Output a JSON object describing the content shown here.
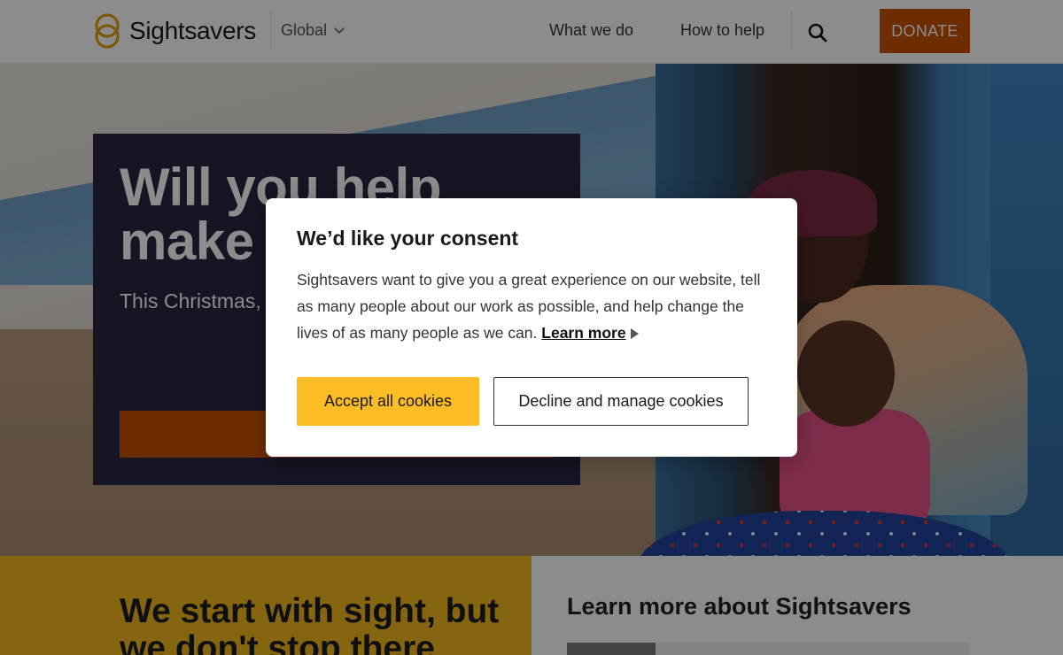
{
  "header": {
    "brand": "Sightsavers",
    "region": "Global",
    "nav": [
      "What we do",
      "How to help"
    ],
    "donate_label": "DONATE"
  },
  "hero": {
    "title": "Will you help make a future",
    "subtitle": "This Christmas, children and fam",
    "cta_label": ""
  },
  "lower": {
    "left_title": "We start with sight, but we don't stop there",
    "right_title": "Learn more about Sightsavers"
  },
  "consent": {
    "title": "We’d like your consent",
    "body": "Sightsavers want to give you a great experience on our website, tell as many people about our work as possible, and help change the lives of as many people as we can.",
    "learn_more": "Learn more",
    "accept_label": "Accept all cookies",
    "decline_label": "Decline and manage cookies"
  },
  "colors": {
    "brand_orange": "#c85200",
    "hero_card": "#2a2540",
    "accent_yellow": "#f5b820",
    "accept_yellow": "#fbbc24"
  },
  "icons": [
    "sightsavers-logo-icon",
    "chevron-down-icon",
    "search-icon",
    "play-arrow-icon"
  ]
}
